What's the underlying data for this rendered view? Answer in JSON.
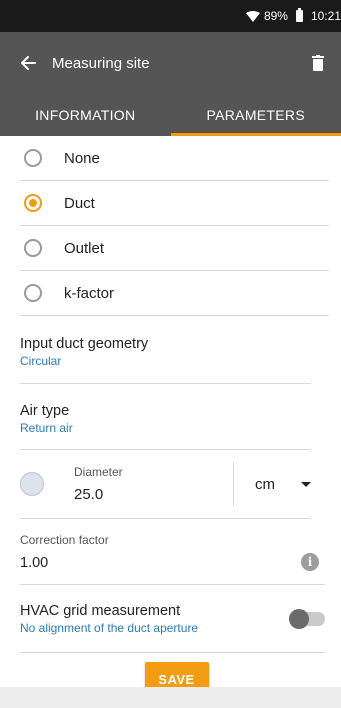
{
  "status_bar": {
    "battery": "89%",
    "time": "10:21",
    "icons": [
      "wifi-icon",
      "battery-icon"
    ]
  },
  "app_bar": {
    "title": "Measuring site",
    "back_icon": "arrow-left-icon",
    "delete_icon": "trash-icon"
  },
  "tabs": [
    {
      "label": "INFORMATION",
      "active": false
    },
    {
      "label": "PARAMETERS",
      "active": true
    }
  ],
  "measurement_options": [
    {
      "label": "None",
      "selected": false
    },
    {
      "label": "Duct",
      "selected": true
    },
    {
      "label": "Outlet",
      "selected": false
    },
    {
      "label": "k-factor",
      "selected": false
    }
  ],
  "duct_geometry": {
    "title": "Input duct geometry",
    "value": "Circular"
  },
  "air_type": {
    "title": "Air type",
    "value": "Return air"
  },
  "diameter": {
    "label": "Diameter",
    "value": "25.0",
    "unit": "cm"
  },
  "correction_factor": {
    "label": "Correction factor",
    "value": "1.00",
    "info_icon": "info-icon"
  },
  "hvac_grid": {
    "title": "HVAC grid measurement",
    "subtitle": "No alignment of the duct aperture",
    "enabled": false
  },
  "save_label": "SAVE",
  "colors": {
    "accent": "#f39c12",
    "app_bar": "#555555",
    "link_blue": "#2b7bb8",
    "status_bar": "#1a1a1a"
  }
}
